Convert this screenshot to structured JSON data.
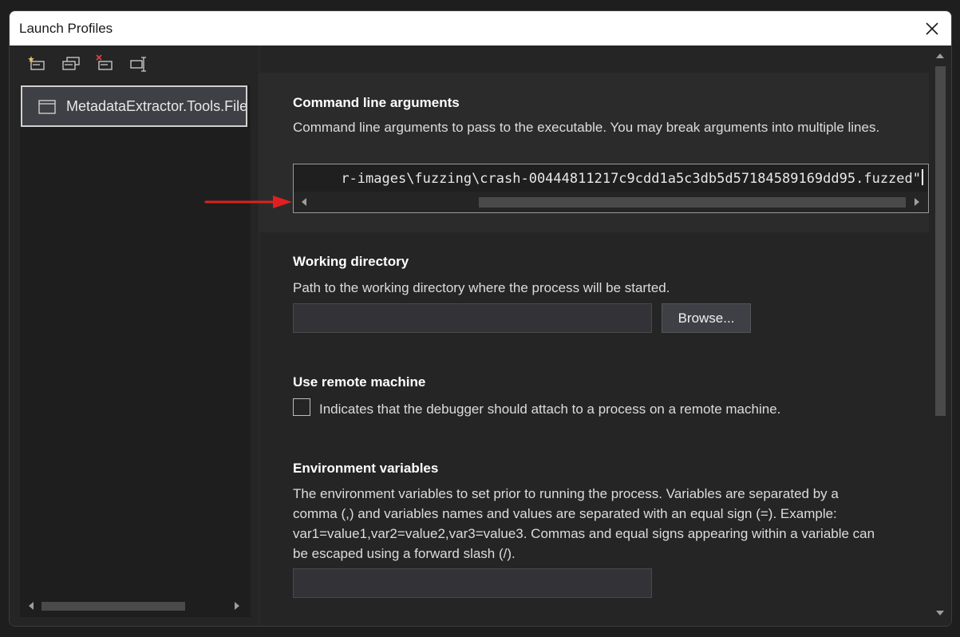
{
  "window": {
    "title": "Launch Profiles",
    "close_icon": "close-icon"
  },
  "toolbar": {
    "buttons": [
      {
        "name": "new-profile",
        "icon": "new-profile-icon"
      },
      {
        "name": "duplicate-profile",
        "icon": "duplicate-profile-icon"
      },
      {
        "name": "delete-profile",
        "icon": "delete-profile-icon"
      },
      {
        "name": "rename-profile",
        "icon": "rename-profile-icon"
      }
    ]
  },
  "profiles": {
    "items": [
      {
        "label": "MetadataExtractor.Tools.FileP"
      }
    ]
  },
  "sections": {
    "command_line": {
      "title": "Command line arguments",
      "description": "Command line arguments to pass to the executable. You may break arguments into multiple lines.",
      "value": "r-images\\fuzzing\\crash-00444811217c9cdd1a5c3db5d57184589169dd95.fuzzed\""
    },
    "working_directory": {
      "title": "Working directory",
      "description": "Path to the working directory where the process will be started.",
      "value": "",
      "browse_label": "Browse..."
    },
    "remote_machine": {
      "title": "Use remote machine",
      "checkbox_label": "Indicates that the debugger should attach to a process on a remote machine.",
      "checked": false
    },
    "environment_variables": {
      "title": "Environment variables",
      "description": "The environment variables to set prior to running the process. Variables are separated by a comma (,) and variables names and values are separated with an equal sign (=). Example: var1=value1,var2=value2,var3=value3. Commas and equal signs appearing within a variable can be escaped using a forward slash (/).",
      "value": ""
    }
  },
  "colors": {
    "background": "#252526",
    "annotation_arrow": "#e02020"
  }
}
